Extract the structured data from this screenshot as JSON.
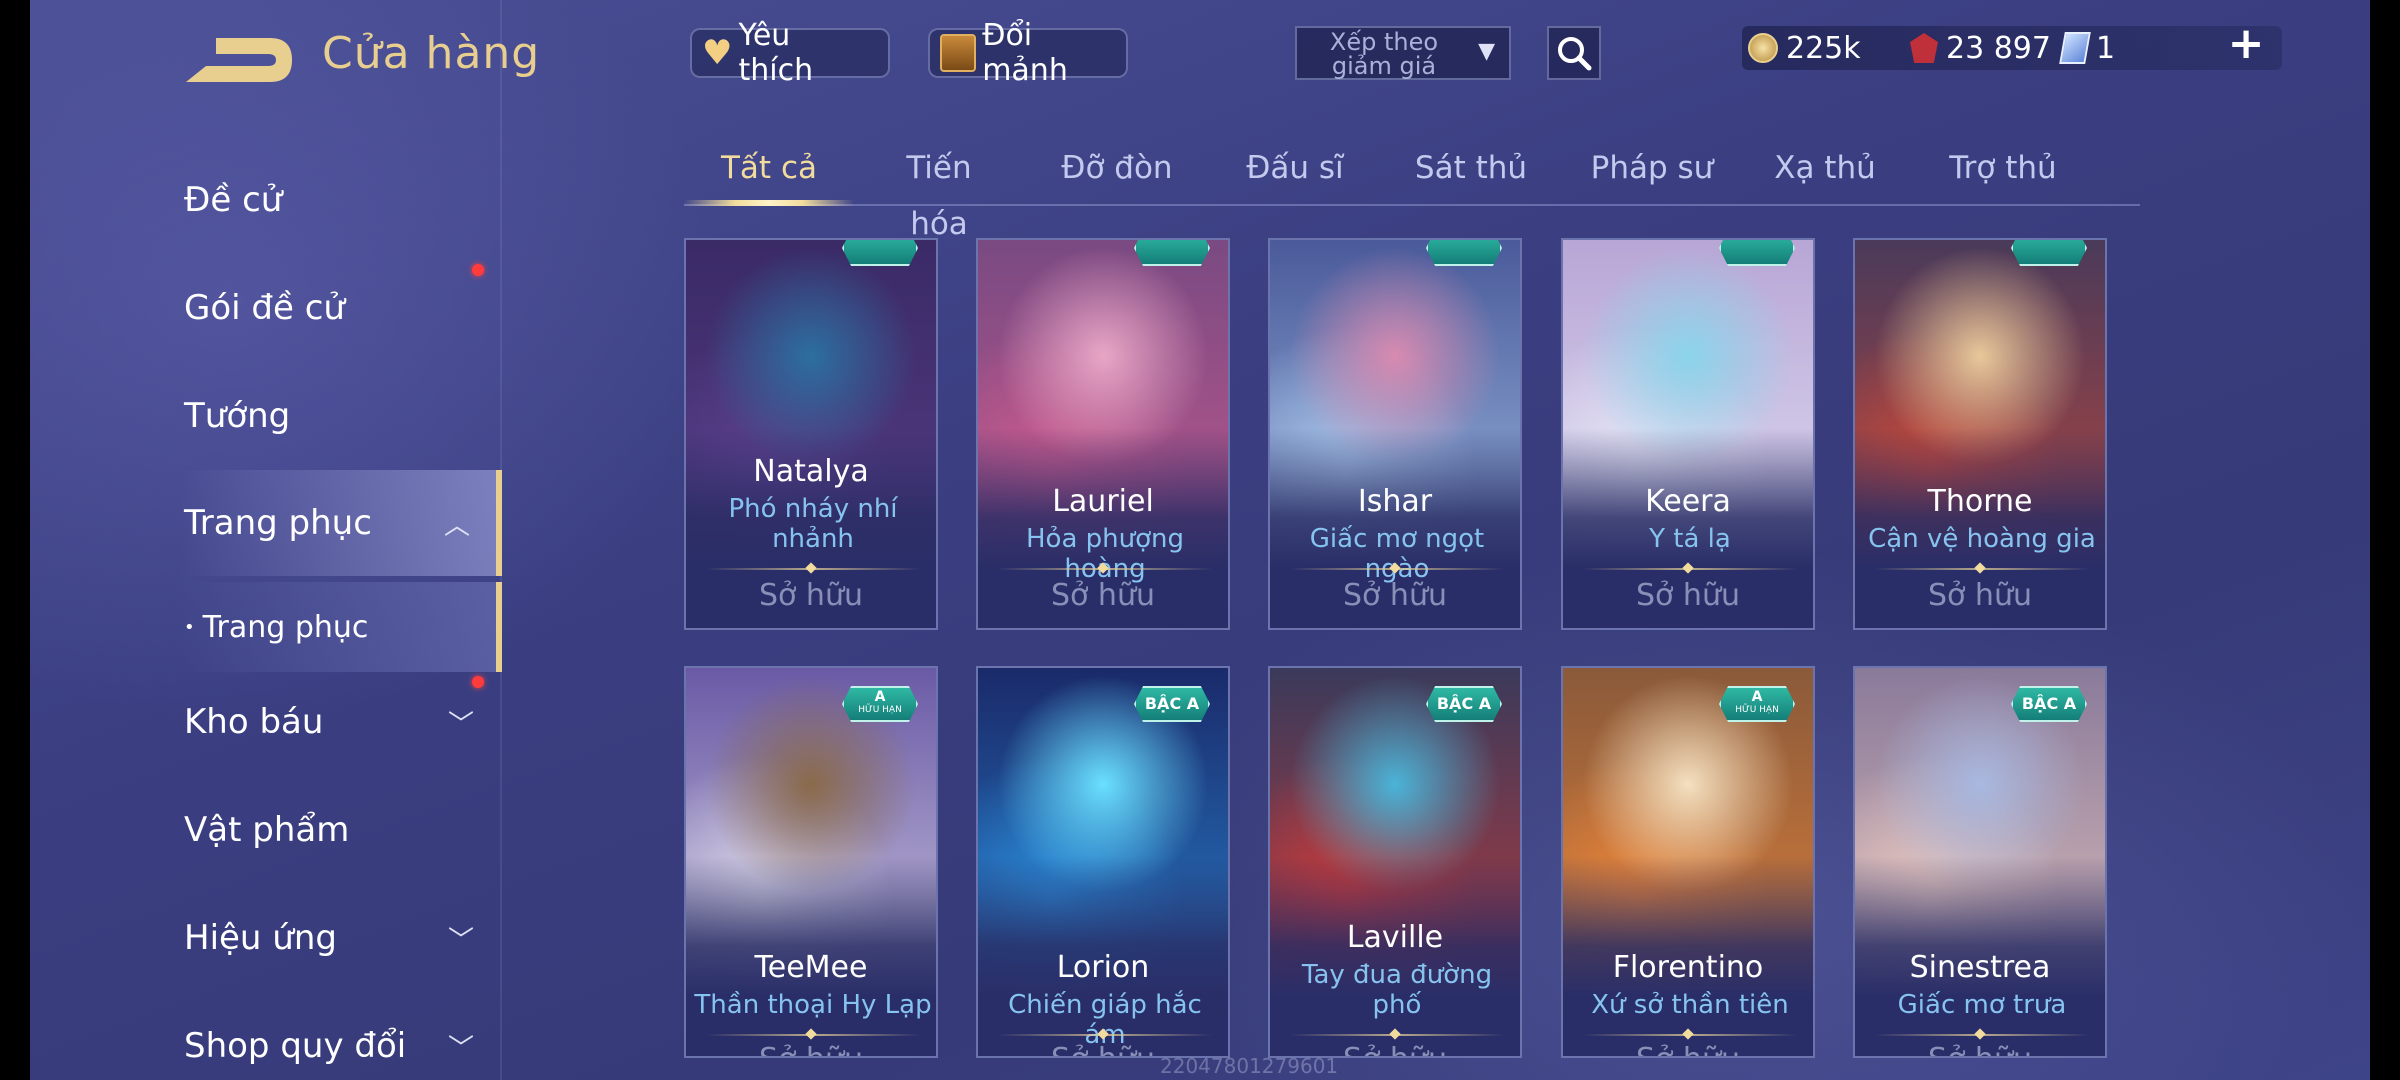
{
  "header": {
    "title": "Cửa hàng",
    "favorite_label": "Yêu thích",
    "exchange_label": "Đổi mảnh",
    "sort_label": "Xếp theo giảm giá",
    "currencies": [
      {
        "icon": "gold-coin-icon",
        "value": "225k"
      },
      {
        "icon": "ruby-icon",
        "value": "23 897"
      },
      {
        "icon": "card-voucher-icon",
        "value": "1"
      }
    ],
    "plus_label": "+"
  },
  "sidebar": {
    "items": [
      {
        "label": "Đề cử"
      },
      {
        "label": "Gói đề cử",
        "notification": true
      },
      {
        "label": "Tướng"
      },
      {
        "label": "Trang phục",
        "expanded": true
      },
      {
        "label": "Trang phục",
        "sub": true,
        "bullet": "•"
      },
      {
        "label": "Kho báu",
        "notification": true
      },
      {
        "label": "Vật phẩm"
      },
      {
        "label": "Hiệu ứng"
      },
      {
        "label": "Shop quy đổi"
      }
    ]
  },
  "tabs": [
    {
      "label": "Tất cả",
      "active": true
    },
    {
      "label": "Tiến hóa"
    },
    {
      "label": "Đỡ đòn"
    },
    {
      "label": "Đấu sĩ"
    },
    {
      "label": "Sát thủ"
    },
    {
      "label": "Pháp sư"
    },
    {
      "label": "Xạ thủ"
    },
    {
      "label": "Trợ thủ"
    }
  ],
  "cards": [
    {
      "hero": "Natalya",
      "skin": "Phó nháy nhí nhảnh",
      "status": "Sở hữu",
      "tag": "",
      "colors": [
        "#5a3f8a",
        "#2c6fa0",
        "#3a2a66"
      ]
    },
    {
      "hero": "Lauriel",
      "skin": "Hỏa phượng hoàng",
      "status": "Sở hữu",
      "tag": "",
      "colors": [
        "#c85a8e",
        "#e8a6c6",
        "#7a4a82"
      ]
    },
    {
      "hero": "Ishar",
      "skin": "Giấc mơ ngọt ngào",
      "status": "Sở hữu",
      "tag": "",
      "colors": [
        "#a8c6ea",
        "#d88ab0",
        "#4a5a9a"
      ]
    },
    {
      "hero": "Keera",
      "skin": "Y tá lạ",
      "status": "Sở hữu",
      "tag": "",
      "colors": [
        "#e6e6f6",
        "#8ad4ea",
        "#b8a6d6"
      ]
    },
    {
      "hero": "Thorne",
      "skin": "Cận vệ hoàng gia",
      "status": "Sở hữu",
      "tag": "",
      "colors": [
        "#c4483a",
        "#e8c89a",
        "#4a3a5a"
      ]
    },
    {
      "hero": "TeeMee",
      "skin": "Thần thoại Hy Lạp",
      "status": "Sở hữu",
      "tag": "A",
      "tag_sub": "HỮU HẠN",
      "colors": [
        "#d8d4e6",
        "#8a6a4a",
        "#6a5aa6"
      ]
    },
    {
      "hero": "Lorion",
      "skin": "Chiến giáp hắc ám",
      "status": "Sở hữu",
      "tag": "BẬC A",
      "colors": [
        "#2a8ad8",
        "#6ae0ff",
        "#1a2a6a"
      ]
    },
    {
      "hero": "Laville",
      "skin": "Tay đua đường phố",
      "status": "Sở hữu",
      "tag": "BẬC A",
      "colors": [
        "#c83a3a",
        "#4ab4d8",
        "#3a3a5a"
      ]
    },
    {
      "hero": "Florentino",
      "skin": "Xứ sở thần tiên",
      "status": "Sở hữu",
      "tag": "A",
      "tag_sub": "HỮU HẠN",
      "colors": [
        "#e8843a",
        "#f4e0c0",
        "#8a5a3a"
      ]
    },
    {
      "hero": "Sinestrea",
      "skin": "Giấc mơ trưa",
      "status": "Sở hữu",
      "tag": "BẬC A",
      "colors": [
        "#e8c8c0",
        "#a8b8e0",
        "#8a7a9a"
      ]
    }
  ],
  "watermark": "2204780127960​1"
}
